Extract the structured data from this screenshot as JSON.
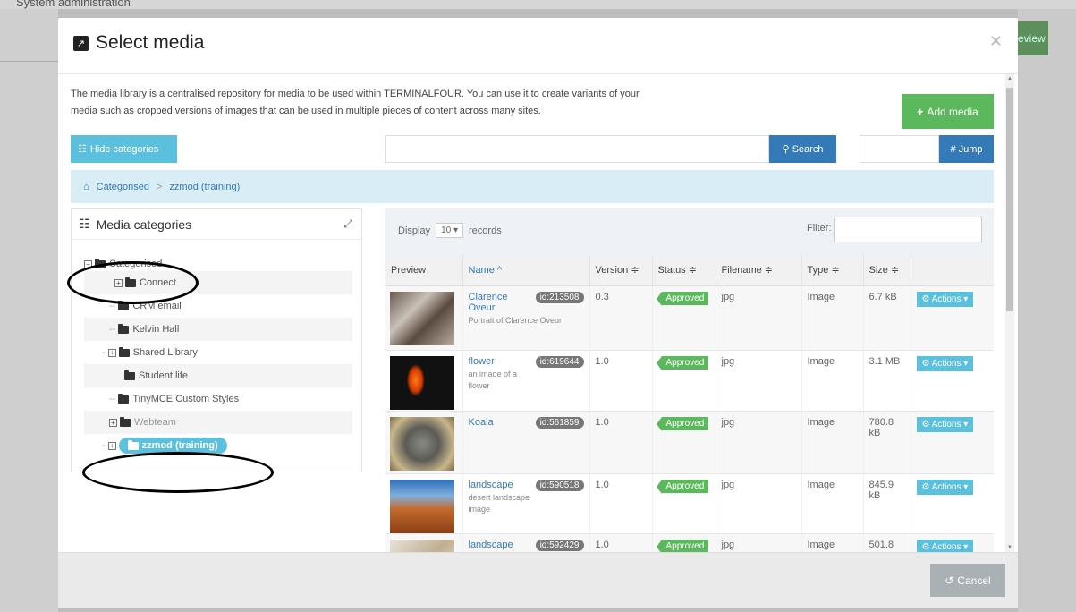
{
  "background": {
    "system_label": "System administration",
    "preview_label": "eview"
  },
  "modal": {
    "title": "Select media",
    "intro_line1": "The media library is a centralised repository for media to be used within TERMINALFOUR. You can use it to create variants of your",
    "intro_line2": "media such as cropped versions of images that can be used in multiple pieces of content across many sites.",
    "add_media_label": "Add media",
    "hide_categories_label": "Hide categories",
    "search_label": "Search",
    "jump_label": "# Jump",
    "cancel_label": "Cancel"
  },
  "breadcrumb": {
    "root": "Categorised",
    "separator": ">",
    "current": "zzmod (training)"
  },
  "categories": {
    "heading": "Media categories",
    "root": "Categorised",
    "items": [
      "Connect",
      "CRM email",
      "Kelvin Hall",
      "Shared Library",
      "Student life",
      "TinyMCE Custom Styles",
      "Webteam",
      "zzmod (training)"
    ]
  },
  "table": {
    "display_label": "Display",
    "display_value": "10",
    "records_label": "records",
    "filter_label": "Filter:",
    "headers": {
      "preview": "Preview",
      "name": "Name ^",
      "version": "Version ≑",
      "status": "Status ≑",
      "filename": "Filename ≑",
      "type": "Type ≑",
      "size": "Size ≑"
    },
    "actions_label": "Actions",
    "rows": [
      {
        "name": "Clarence Oveur",
        "id": "id:213508",
        "desc": "Portrait of Clarence Oveur",
        "version": "0.3",
        "status": "Approved",
        "filename": "jpg",
        "type": "Image",
        "size": "6.7 kB"
      },
      {
        "name": "flower",
        "id": "id:619644",
        "desc": "an image of a flower",
        "version": "1.0",
        "status": "Approved",
        "filename": "jpg",
        "type": "Image",
        "size": "3.1 MB"
      },
      {
        "name": "Koala",
        "id": "id:561859",
        "desc": "",
        "version": "1.0",
        "status": "Approved",
        "filename": "jpg",
        "type": "Image",
        "size": "780.8 kB"
      },
      {
        "name": "landscape",
        "id": "id:590518",
        "desc": "desert landscape image",
        "version": "1.0",
        "status": "Approved",
        "filename": "jpg",
        "type": "Image",
        "size": "845.9 kB"
      },
      {
        "name": "landscape",
        "id": "id:592429",
        "desc": "",
        "version": "1.0",
        "status": "Approved",
        "filename": "jpg",
        "type": "Image",
        "size": "501.8"
      }
    ]
  },
  "colors": {
    "primary": "#337ab7",
    "info": "#5bc0de",
    "success": "#5cb85c"
  }
}
